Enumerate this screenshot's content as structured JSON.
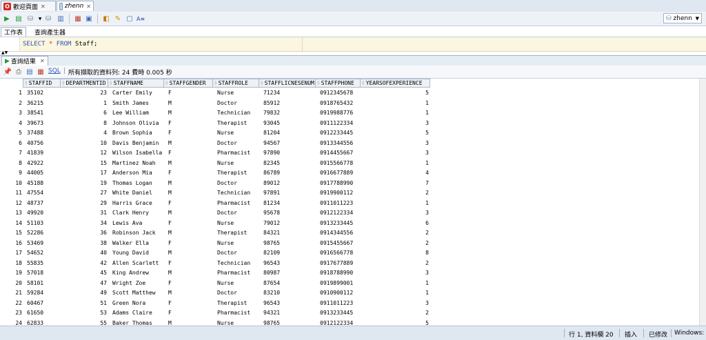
{
  "tabs": [
    {
      "label": "歡迎頁面",
      "icon": "oracle-logo-icon",
      "active": false
    },
    {
      "label": "zhenn",
      "icon": "database-icon",
      "active": true
    }
  ],
  "connection": {
    "label": "zhenn"
  },
  "worksheet_tabs": [
    "工作表",
    "查詢產生器"
  ],
  "editor": {
    "sql_keyword_select": "SELECT",
    "sql_star": "*",
    "sql_keyword_from": "FROM",
    "sql_table": "Staff;"
  },
  "results": {
    "tab_label": "查詢結果",
    "sql_link": "SQL",
    "status": "所有擷取的資料列: 24 費時 0.005 秒",
    "columns": [
      "STAFFID",
      "DEPARTMENTID",
      "STAFFNAME",
      "STAFFGENDER",
      "STAFFROLE",
      "STAFFLICNESENUM",
      "STAFFPHONE",
      "YEARSOFEXPERIENCE"
    ],
    "rows": [
      [
        "1",
        "35102",
        "23",
        "Carter Emily",
        "F",
        "Nurse",
        "71234",
        "0912345678",
        "5"
      ],
      [
        "2",
        "36215",
        "1",
        "Smith James",
        "M",
        "Doctor",
        "85912",
        "0918765432",
        "1"
      ],
      [
        "3",
        "38541",
        "6",
        "Lee William",
        "M",
        "Technician",
        "79832",
        "0919988776",
        "1"
      ],
      [
        "4",
        "39673",
        "8",
        "Johnson Olivia",
        "F",
        "Therapist",
        "93045",
        "0911122334",
        "3"
      ],
      [
        "5",
        "37488",
        "4",
        "Brown Sophia",
        "F",
        "Nurse",
        "81204",
        "0912233445",
        "5"
      ],
      [
        "6",
        "40756",
        "10",
        "Davis Benjamin",
        "M",
        "Doctor",
        "94567",
        "0913344556",
        "3"
      ],
      [
        "7",
        "41839",
        "12",
        "Wilson Isabella",
        "F",
        "Pharmacist",
        "97890",
        "0914455667",
        "3"
      ],
      [
        "8",
        "42922",
        "15",
        "Martinez Noah",
        "M",
        "Nurse",
        "82345",
        "0915566778",
        "1"
      ],
      [
        "9",
        "44005",
        "17",
        "Anderson Mia",
        "F",
        "Therapist",
        "86789",
        "0916677889",
        "4"
      ],
      [
        "10",
        "45188",
        "19",
        "Thomas Logan",
        "M",
        "Doctor",
        "89012",
        "0917788990",
        "7"
      ],
      [
        "11",
        "47554",
        "27",
        "White Daniel",
        "M",
        "Technician",
        "97891",
        "0919900112",
        "2"
      ],
      [
        "12",
        "48737",
        "29",
        "Harris Grace",
        "F",
        "Pharmacist",
        "81234",
        "0911011223",
        "1"
      ],
      [
        "13",
        "49920",
        "31",
        "Clark Henry",
        "M",
        "Doctor",
        "95678",
        "0912122334",
        "3"
      ],
      [
        "14",
        "51103",
        "34",
        "Lewis Ava",
        "F",
        "Nurse",
        "79012",
        "0913233445",
        "6"
      ],
      [
        "15",
        "52286",
        "36",
        "Robinson Jack",
        "M",
        "Therapist",
        "84321",
        "0914344556",
        "2"
      ],
      [
        "16",
        "53469",
        "38",
        "Walker Ella",
        "F",
        "Nurse",
        "98765",
        "0915455667",
        "2"
      ],
      [
        "17",
        "54652",
        "40",
        "Young David",
        "M",
        "Doctor",
        "82109",
        "0916566778",
        "8"
      ],
      [
        "18",
        "55835",
        "42",
        "Allen Scarlett",
        "F",
        "Technician",
        "96543",
        "0917677889",
        "2"
      ],
      [
        "19",
        "57018",
        "45",
        "King Andrew",
        "M",
        "Pharmacist",
        "80987",
        "0918788990",
        "3"
      ],
      [
        "20",
        "58101",
        "47",
        "Wright Zoe",
        "F",
        "Nurse",
        "87654",
        "0919899001",
        "1"
      ],
      [
        "21",
        "59284",
        "49",
        "Scott Matthew",
        "M",
        "Doctor",
        "83210",
        "0910900112",
        "1"
      ],
      [
        "22",
        "60467",
        "51",
        "Green Nora",
        "F",
        "Therapist",
        "96543",
        "0911011223",
        "3"
      ],
      [
        "23",
        "61650",
        "53",
        "Adams Claire",
        "F",
        "Pharmacist",
        "94321",
        "0913233445",
        "2"
      ],
      [
        "24",
        "62833",
        "55",
        "Baker Thomas",
        "M",
        "Nurse",
        "98765",
        "0912122334",
        "5"
      ]
    ]
  },
  "statusbar": {
    "position": "行 1, 資料欄 20",
    "mode": "插入",
    "modified": "已修改",
    "encoding": "Windows: CR"
  }
}
